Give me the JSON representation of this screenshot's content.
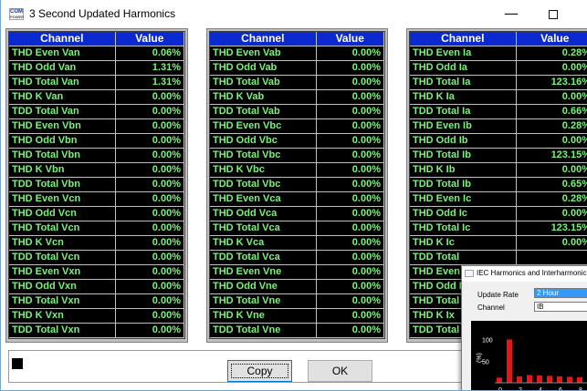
{
  "window": {
    "title": "3 Second Updated Harmonics",
    "icon_text": "COM",
    "icon_subtext": "POWER",
    "controls": [
      "minimize-icon",
      "maximize-icon",
      "close-icon"
    ]
  },
  "colors": {
    "header_bg": "#0a2acf",
    "value_text": "#7cf27c",
    "grid_bg": "#000000"
  },
  "tables": [
    {
      "headers": [
        "Channel",
        "Value"
      ],
      "rows": [
        [
          "THD Even Van",
          "0.06%"
        ],
        [
          "THD Odd Van",
          "1.31%"
        ],
        [
          "THD Total Van",
          "1.31%"
        ],
        [
          "THD K Van",
          "0.00%"
        ],
        [
          "TDD Total Van",
          "0.00%"
        ],
        [
          "THD Even Vbn",
          "0.00%"
        ],
        [
          "THD Odd Vbn",
          "0.00%"
        ],
        [
          "THD Total Vbn",
          "0.00%"
        ],
        [
          "THD K Vbn",
          "0.00%"
        ],
        [
          "TDD Total Vbn",
          "0.00%"
        ],
        [
          "THD Even Vcn",
          "0.00%"
        ],
        [
          "THD Odd Vcn",
          "0.00%"
        ],
        [
          "THD Total Vcn",
          "0.00%"
        ],
        [
          "THD K Vcn",
          "0.00%"
        ],
        [
          "TDD Total Vcn",
          "0.00%"
        ],
        [
          "THD Even Vxn",
          "0.00%"
        ],
        [
          "THD Odd Vxn",
          "0.00%"
        ],
        [
          "THD Total Vxn",
          "0.00%"
        ],
        [
          "THD K Vxn",
          "0.00%"
        ],
        [
          "TDD Total Vxn",
          "0.00%"
        ]
      ]
    },
    {
      "headers": [
        "Channel",
        "Value"
      ],
      "rows": [
        [
          "THD Even Vab",
          "0.00%"
        ],
        [
          "THD Odd Vab",
          "0.00%"
        ],
        [
          "THD Total Vab",
          "0.00%"
        ],
        [
          "THD K Vab",
          "0.00%"
        ],
        [
          "TDD Total Vab",
          "0.00%"
        ],
        [
          "THD Even Vbc",
          "0.00%"
        ],
        [
          "THD Odd Vbc",
          "0.00%"
        ],
        [
          "THD Total Vbc",
          "0.00%"
        ],
        [
          "THD K Vbc",
          "0.00%"
        ],
        [
          "TDD Total Vbc",
          "0.00%"
        ],
        [
          "THD Even Vca",
          "0.00%"
        ],
        [
          "THD Odd Vca",
          "0.00%"
        ],
        [
          "THD Total Vca",
          "0.00%"
        ],
        [
          "THD K Vca",
          "0.00%"
        ],
        [
          "TDD Total Vca",
          "0.00%"
        ],
        [
          "THD Even Vne",
          "0.00%"
        ],
        [
          "THD Odd Vne",
          "0.00%"
        ],
        [
          "THD Total Vne",
          "0.00%"
        ],
        [
          "THD K Vne",
          "0.00%"
        ],
        [
          "TDD Total Vne",
          "0.00%"
        ]
      ]
    },
    {
      "headers": [
        "Channel",
        "Value"
      ],
      "rows": [
        [
          "THD Even Ia",
          "0.28%"
        ],
        [
          "THD Odd Ia",
          "0.00%"
        ],
        [
          "THD Total Ia",
          "123.16%"
        ],
        [
          "THD K Ia",
          "0.00%"
        ],
        [
          "TDD Total Ia",
          "0.66%"
        ],
        [
          "THD Even Ib",
          "0.28%"
        ],
        [
          "THD Odd Ib",
          "0.00%"
        ],
        [
          "THD Total Ib",
          "123.15%"
        ],
        [
          "THD K Ib",
          "0.00%"
        ],
        [
          "TDD Total Ib",
          "0.65%"
        ],
        [
          "THD Even Ic",
          "0.28%"
        ],
        [
          "THD Odd Ic",
          "0.00%"
        ],
        [
          "THD Total Ic",
          "123.15%"
        ],
        [
          "THD K Ic",
          "0.00%"
        ],
        [
          "TDD Total",
          ""
        ],
        [
          "THD Even",
          ""
        ],
        [
          "THD Odd I",
          ""
        ],
        [
          "THD Total",
          ""
        ],
        [
          "THD K Ix",
          ""
        ],
        [
          "TDD Total",
          ""
        ]
      ]
    }
  ],
  "buttons": {
    "copy": "Copy",
    "ok": "OK"
  },
  "overlay": {
    "title": "IEC Harmonics and Interharmonics",
    "update_rate_label": "Update Rate",
    "update_rate_value": "2 Hour",
    "channel_label": "Channel",
    "channel_value": "IB",
    "chart": {
      "y_ticks": [
        "100",
        "50"
      ],
      "y_axis_label": "(%)",
      "x_ticks": [
        "0",
        "2",
        "4",
        "6",
        "8"
      ]
    }
  },
  "chart_data": {
    "type": "bar",
    "title": "",
    "ylim": [
      0,
      120
    ],
    "y_ticks": [
      50,
      100
    ],
    "x_ticks": [
      0,
      2,
      4,
      6,
      8
    ],
    "categories": [
      "1",
      "1.5",
      "2",
      "3",
      "4",
      "5",
      "6",
      "7",
      "8"
    ],
    "values": [
      12,
      100,
      15,
      18,
      17,
      16,
      15,
      14,
      13
    ]
  }
}
